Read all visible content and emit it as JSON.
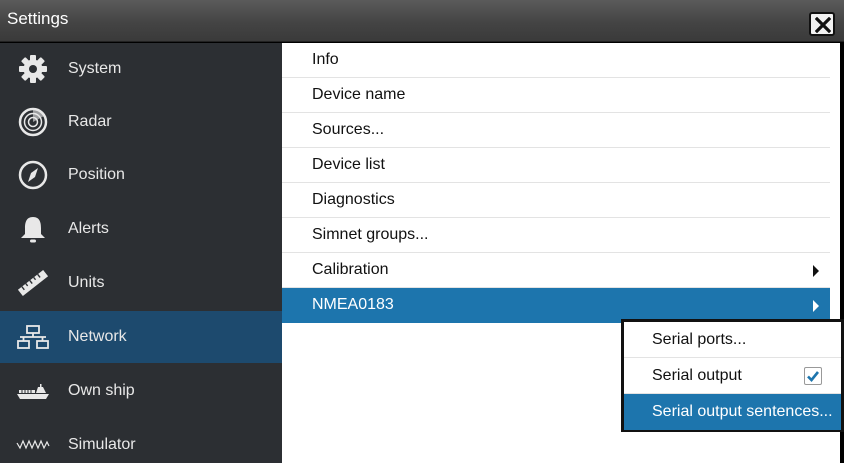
{
  "window": {
    "title": "Settings"
  },
  "sidebar": {
    "items": [
      {
        "label": "System",
        "icon": "gear-icon",
        "active": false
      },
      {
        "label": "Radar",
        "icon": "radar-icon",
        "active": false
      },
      {
        "label": "Position",
        "icon": "compass-icon",
        "active": false
      },
      {
        "label": "Alerts",
        "icon": "bell-icon",
        "active": false
      },
      {
        "label": "Units",
        "icon": "ruler-icon",
        "active": false
      },
      {
        "label": "Network",
        "icon": "network-icon",
        "active": true
      },
      {
        "label": "Own ship",
        "icon": "ship-icon",
        "active": false
      },
      {
        "label": "Simulator",
        "icon": "simulator-icon",
        "active": false
      }
    ]
  },
  "network_menu": {
    "items": [
      {
        "label": "Info"
      },
      {
        "label": "Device name"
      },
      {
        "label": "Sources..."
      },
      {
        "label": "Device list"
      },
      {
        "label": "Diagnostics"
      },
      {
        "label": "Simnet groups..."
      },
      {
        "label": "Calibration",
        "has_submenu": true
      },
      {
        "label": "NMEA0183",
        "has_submenu": true,
        "selected": true
      }
    ]
  },
  "nmea_submenu": {
    "items": [
      {
        "label": "Serial ports..."
      },
      {
        "label": "Serial output",
        "checked": true
      },
      {
        "label": "Serial output sentences...",
        "selected": true
      }
    ]
  },
  "colors": {
    "accent": "#1d75ad",
    "sidebar_bg": "#2c2f33",
    "sidebar_active": "#1d4a6e",
    "checkmark": "#1d75ad"
  }
}
